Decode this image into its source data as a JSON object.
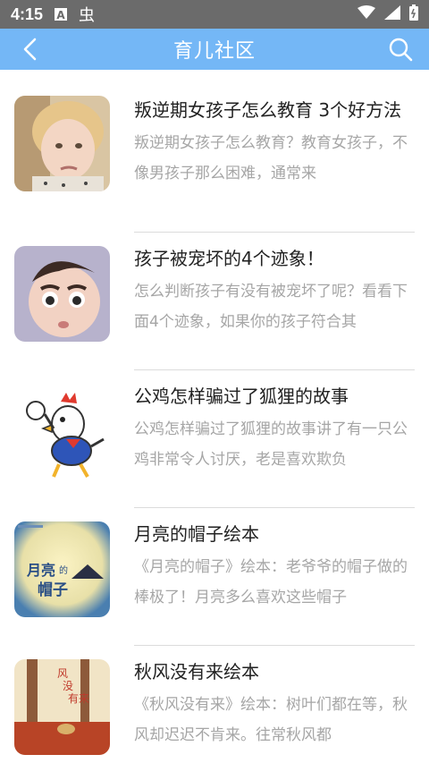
{
  "status": {
    "time": "4:15",
    "icons": [
      "a-box-icon",
      "bug-icon"
    ],
    "right_icons": [
      "wifi-icon",
      "signal-icon",
      "battery-icon"
    ]
  },
  "appbar": {
    "title": "育儿社区",
    "back_icon": "back-chevron-icon",
    "search_icon": "search-icon"
  },
  "colors": {
    "appbar": "#74b7f6",
    "statusbar": "#6b6b6b",
    "title_text": "#222222",
    "desc_text": "#a6a6a6"
  },
  "articles": [
    {
      "title": "叛逆期女孩子怎么教育 3个好方法",
      "desc": "叛逆期女孩子怎么教育？教育女孩子，不像男孩子那么困难，通常来",
      "thumb": "angry-girl-photo"
    },
    {
      "title": "孩子被宠坏的4个迹象！",
      "desc": "怎么判断孩子有没有被宠坏了呢？看看下面4个迹象，如果你的孩子符合其",
      "thumb": "baby-photo"
    },
    {
      "title": "公鸡怎样骗过了狐狸的故事",
      "desc": "公鸡怎样骗过了狐狸的故事讲了有一只公鸡非常令人讨厌，老是喜欢欺负",
      "thumb": "rooster-cartoon"
    },
    {
      "title": "月亮的帽子绘本",
      "desc": "《月亮的帽子》绘本：老爷爷的帽子做的棒极了！月亮多么喜欢这些帽子",
      "thumb": "moon-hat-book-cover",
      "cover_text": "月亮的帽子"
    },
    {
      "title": "秋风没有来绘本",
      "desc": "《秋风没有来》绘本：树叶们都在等，秋风却迟迟不肯来。往常秋风都",
      "thumb": "autumn-book-cover",
      "cover_text": "秋风没有来"
    }
  ]
}
